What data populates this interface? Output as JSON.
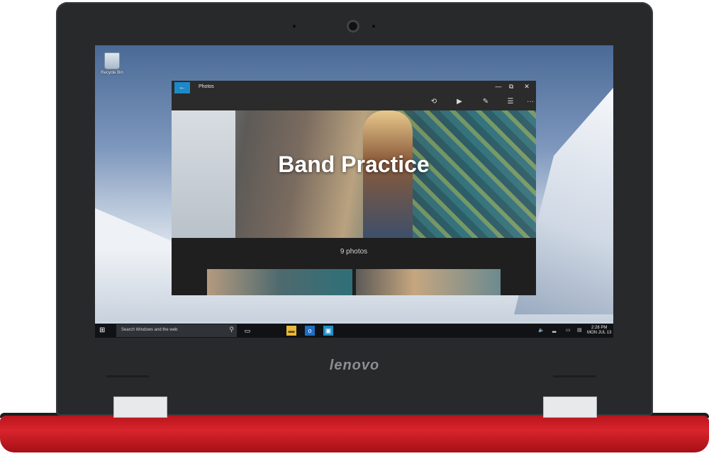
{
  "device": {
    "brand": "lenovo"
  },
  "desktop": {
    "recycle_bin_label": "Recycle Bin"
  },
  "photos_window": {
    "app_title": "Photos",
    "back_icon": "arrow-left-icon",
    "controls": {
      "minimize": "—",
      "maximize": "⧉",
      "close": "✕"
    },
    "commands": [
      {
        "name": "share-icon",
        "glyph": "⟲"
      },
      {
        "name": "slideshow-icon",
        "glyph": "▶"
      },
      {
        "name": "edit-icon",
        "glyph": "✎"
      },
      {
        "name": "select-icon",
        "glyph": "☰"
      },
      {
        "name": "more-icon",
        "glyph": "···"
      }
    ],
    "album_title": "Band Practice",
    "photo_count": "9 photos"
  },
  "taskbar": {
    "search_placeholder": "Search Windows and the web",
    "time": "2:28 PM",
    "date": "MON JUL 13"
  },
  "colors": {
    "accent": "#1e88c8",
    "base_red": "#d9242c",
    "bezel": "#28292b"
  }
}
